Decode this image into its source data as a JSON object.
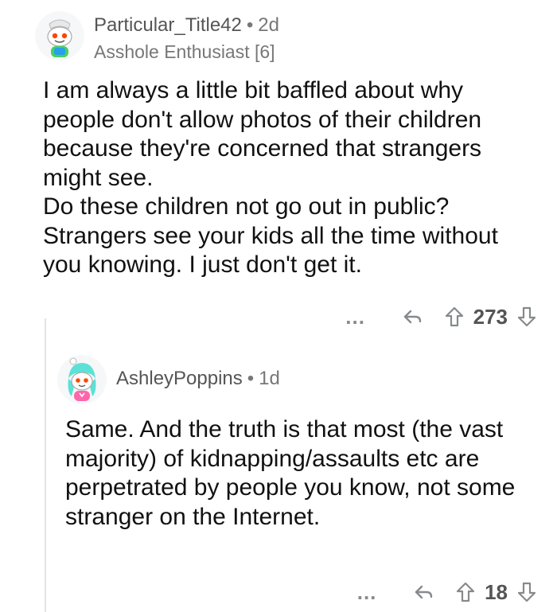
{
  "comments": [
    {
      "username": "Particular_Title42",
      "separator": "•",
      "age": "2d",
      "flair": "Asshole Enthusiast [6]",
      "paragraphs": [
        "I am always a little bit baffled about why people don't allow photos of their children because they're concerned that strangers might see.",
        "Do these children not go out in public? Strangers see your kids all the time without you knowing. I just don't get it."
      ],
      "more": "...",
      "score": "273"
    },
    {
      "username": "AshleyPoppins",
      "separator": "•",
      "age": "1d",
      "paragraphs": [
        "Same. And the truth is that most (the vast majority) of kidnapping/assaults etc are perpetrated by people you know, not some stranger on the Internet."
      ],
      "more": "...",
      "score": "18"
    }
  ],
  "icons": {
    "reply": "reply-arrow-icon",
    "upvote": "upvote-arrow-icon",
    "downvote": "downvote-arrow-icon"
  },
  "colors": {
    "text": "#111111",
    "meta": "#777777",
    "icon": "#878a8c"
  }
}
